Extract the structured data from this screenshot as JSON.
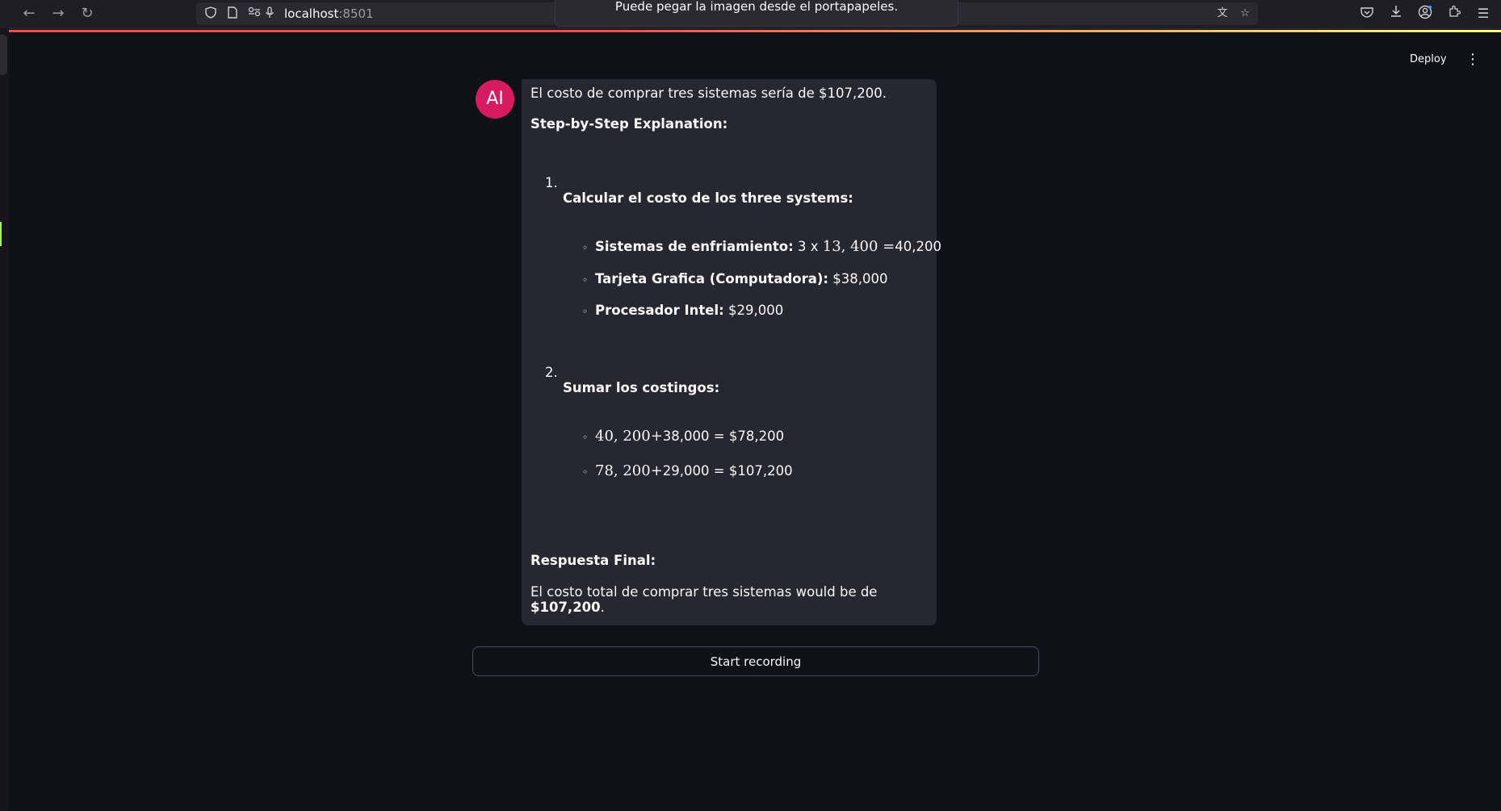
{
  "browser": {
    "url_host": "localhost",
    "url_port": ":8501",
    "clipboard_notice": "Puede pegar la imagen desde el portapapeles."
  },
  "header": {
    "deploy_label": "Deploy"
  },
  "message": {
    "avatar_label": "AI",
    "intro": "El costo de comprar tres sistemas sería de $107,200.",
    "explanation_heading": "Step-by-Step Explanation:",
    "steps": [
      {
        "number": "1.",
        "title": "Calcular el costo de los three systems:",
        "items": [
          {
            "label": "Sistemas de enfriamiento:",
            "pre": "3 x ",
            "math": "13, 400 =",
            "post": "40,200"
          },
          {
            "label": "Tarjeta Grafica (Computadora):",
            "value": "$38,000"
          },
          {
            "label": "Procesador Intel:",
            "value": "$29,000"
          }
        ]
      },
      {
        "number": "2.",
        "title": "Sumar los costingos:",
        "items": [
          {
            "math": "40, 200+",
            "rest": "38,000 = $78,200"
          },
          {
            "math": "78, 200+",
            "rest": "29,000 = $107,200"
          }
        ]
      }
    ],
    "final_heading": "Respuesta Final:",
    "final_text": "El costo total de comprar tres sistemas would be de",
    "final_value": "$107,200",
    "final_end": "."
  },
  "controls": {
    "record_label": "Start recording"
  }
}
